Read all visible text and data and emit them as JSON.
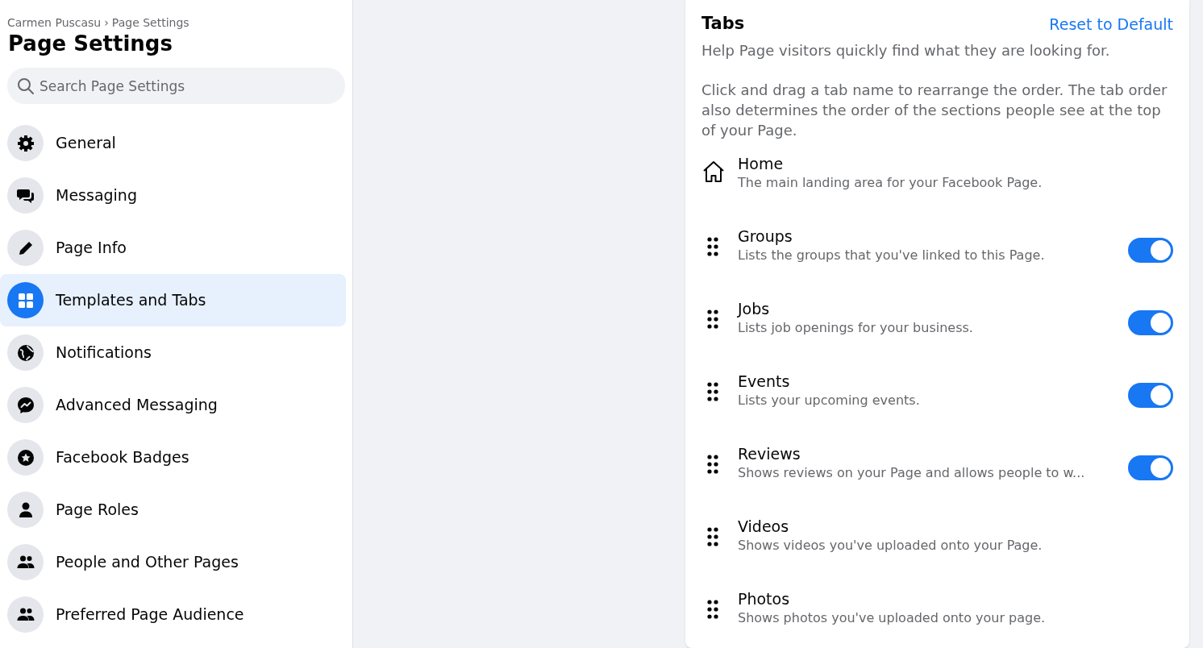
{
  "sidebar": {
    "breadcrumb": [
      {
        "label": "Carmen Puscasu"
      },
      {
        "label": "Page Settings"
      }
    ],
    "breadcrumb_separator": "›",
    "title": "Page Settings",
    "search": {
      "placeholder": "Search Page Settings"
    },
    "items": [
      {
        "label": "General",
        "selected": false
      },
      {
        "label": "Messaging",
        "selected": false
      },
      {
        "label": "Page Info",
        "selected": false
      },
      {
        "label": "Templates and Tabs",
        "selected": true
      },
      {
        "label": "Notifications",
        "selected": false
      },
      {
        "label": "Advanced Messaging",
        "selected": false
      },
      {
        "label": "Facebook Badges",
        "selected": false
      },
      {
        "label": "Page Roles",
        "selected": false
      },
      {
        "label": "People and Other Pages",
        "selected": false
      },
      {
        "label": "Preferred Page Audience",
        "selected": false
      }
    ]
  },
  "panel": {
    "title": "Tabs",
    "reset_link": "Reset to Default",
    "intro": "Help Page visitors quickly find what they are looking for.",
    "instructions": "Click and drag a tab name to rearrange the order. The tab order also determines the order of the sections people see at the top of your Page.",
    "tabs": [
      {
        "kind": "fixed",
        "name": "Home",
        "description": "The main landing area for your Facebook Page."
      },
      {
        "kind": "toggle",
        "name": "Groups",
        "description": "Lists the groups that you've linked to this Page.",
        "on": true
      },
      {
        "kind": "toggle",
        "name": "Jobs",
        "description": "Lists job openings for your business.",
        "on": true
      },
      {
        "kind": "toggle",
        "name": "Events",
        "description": "Lists your upcoming events.",
        "on": true
      },
      {
        "kind": "toggle",
        "name": "Reviews",
        "description": "Shows reviews on your Page and allows people to w...",
        "on": true
      },
      {
        "kind": "draggable",
        "name": "Videos",
        "description": "Shows videos you've uploaded onto your Page."
      },
      {
        "kind": "draggable",
        "name": "Photos",
        "description": "Shows photos you've uploaded onto your page."
      }
    ]
  }
}
